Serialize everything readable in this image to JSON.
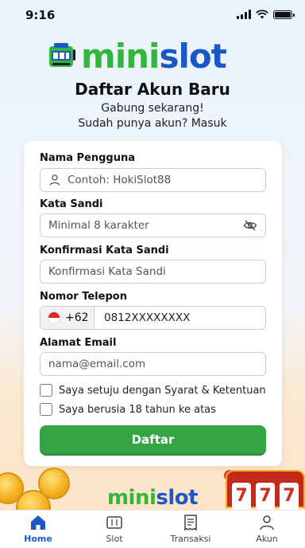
{
  "status": {
    "time": "9:16"
  },
  "brand": {
    "mini": "mini",
    "slot": "slot"
  },
  "header": {
    "title": "Daftar Akun Baru",
    "subtitle1": "Gabung sekarang!",
    "subtitle2_prefix": "Sudah punya akun?",
    "login_link": "Masuk"
  },
  "form": {
    "username_label": "Nama Pengguna",
    "username_placeholder": "Contoh: HokiSlot88",
    "password_label": "Kata Sandi",
    "password_placeholder": "Minimal 8 karakter",
    "confirm_label": "Konfirmasi Kata Sandi",
    "confirm_placeholder": "Konfirmasi Kata Sandi",
    "phone_label": "Nomor Telepon",
    "phone_code": "+62",
    "phone_placeholder": "0812XXXXXXXX",
    "email_label": "Alamat Email",
    "email_placeholder": "nama@email.com",
    "terms_label": "Saya setuju dengan Syarat & Ketentuan",
    "age_label": "Saya berusia 18 tahun ke atas",
    "submit_label": "Daftar"
  },
  "reels": [
    "7",
    "7",
    "7"
  ],
  "nav": [
    {
      "label": "Home",
      "icon": "home-icon",
      "active": true
    },
    {
      "label": "Slot",
      "icon": "slot-icon",
      "active": false
    },
    {
      "label": "Transaksi",
      "icon": "receipt-icon",
      "active": false
    },
    {
      "label": "Akun",
      "icon": "user-icon",
      "active": false
    }
  ],
  "colors": {
    "green": "#35a444",
    "blue": "#1c57c8",
    "brand_green": "#34b53b"
  }
}
